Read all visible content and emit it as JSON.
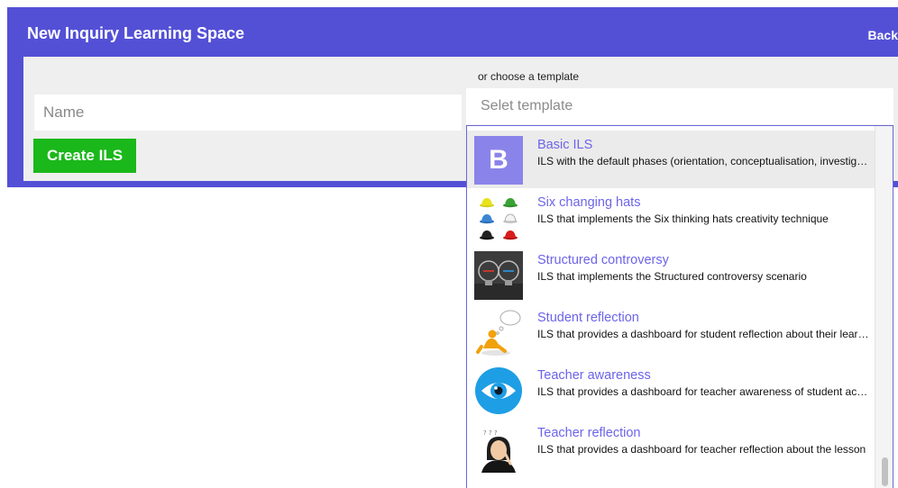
{
  "header": {
    "title": "New Inquiry Learning Space",
    "back_label": "Back"
  },
  "form": {
    "name_placeholder": "Name",
    "create_label": "Create ILS",
    "template_hint": "or choose a template",
    "template_placeholder": "Selet template"
  },
  "templates": [
    {
      "letter": "B",
      "icon": "letter-b-icon",
      "name": "Basic ILS",
      "description": "ILS with the default phases (orientation, conceptualisation, investigation, conclusion, discussion)",
      "selected": true
    },
    {
      "icon": "six-hats-icon",
      "name": "Six changing hats",
      "description": "ILS that implements the Six thinking hats creativity technique"
    },
    {
      "icon": "lightbulbs-icon",
      "name": "Structured controversy",
      "description": "ILS that implements the Structured controversy scenario"
    },
    {
      "icon": "thinking-figure-icon",
      "name": "Student reflection",
      "description": "ILS that provides a dashboard for student reflection about their learning"
    },
    {
      "icon": "eye-icon",
      "name": "Teacher awareness",
      "description": "ILS that provides a dashboard for teacher awareness of student activity"
    },
    {
      "icon": "thinking-woman-icon",
      "name": "Teacher reflection",
      "description": "ILS that provides a dashboard for teacher reflection about the lesson"
    }
  ],
  "colors": {
    "header_bg": "#5450d6",
    "create_button": "#1ab81a",
    "template_name": "#6c64e8"
  }
}
